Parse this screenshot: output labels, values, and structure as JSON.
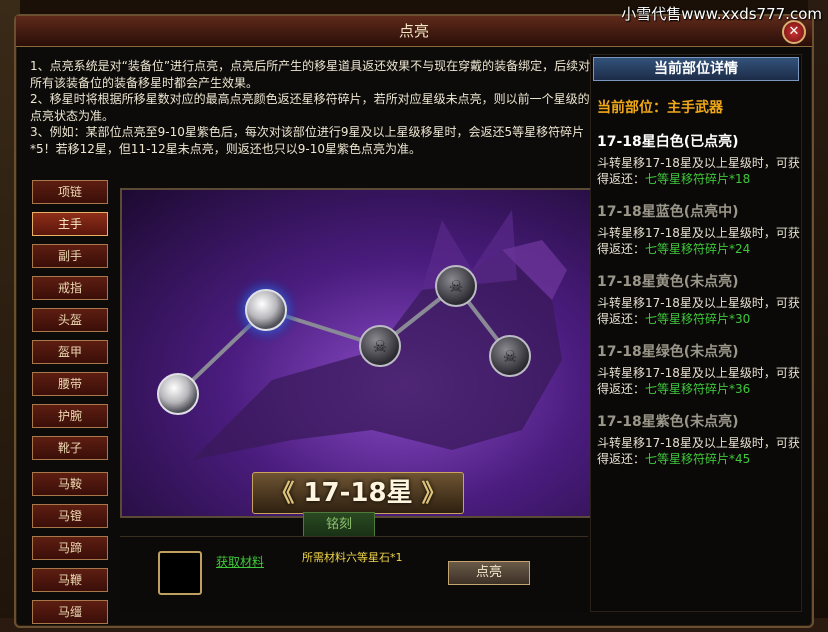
{
  "watermark": "小雪代售www.xxds777.com",
  "window": {
    "title": "点亮",
    "close_icon": "close-icon"
  },
  "notes": [
    "1、点亮系统是对“装备位”进行点亮，点亮后所产生的移星道具返还效果不与现在穿戴的装备绑定，后续对所有该装备位的装备移星时都会产生效果。",
    "2、移星时将根据所移星数对应的最高点亮颜色返还星移符碎片，若所对应星级未点亮，则以前一个星级的点亮状态为准。",
    "3、例如：某部位点亮至9-10星紫色后，每次对该部位进行9星及以上星级移星时，会返还5等星移符碎片*5！若移12星，但11-12星未点亮，则返还也只以9-10星紫色点亮为准。"
  ],
  "equipment_tabs": [
    "项链",
    "主手",
    "副手",
    "戒指",
    "头盔",
    "盔甲",
    "腰带",
    "护腕",
    "靴子"
  ],
  "mount_tabs": [
    "马鞍",
    "马镫",
    "马蹄",
    "马鞭",
    "马缰"
  ],
  "active_tab": "主手",
  "star_banner": {
    "left": "《",
    "label": "17-18星",
    "right": "》"
  },
  "engrave_label": "铭刻",
  "bottom": {
    "acquire_label": "获取材料",
    "required_text": "所需材料六等星石*1",
    "light_button": "点亮"
  },
  "detail": {
    "header": "当前部位详情",
    "part_title": "当前部位：主手武器",
    "desc_prefix": "斗转星移17-18星及以上星级时，可获得返还：",
    "tiers": [
      {
        "name": "17-18星白色(已点亮)",
        "reward": "七等星移符碎片*18",
        "lit": true
      },
      {
        "name": "17-18星蓝色(点亮中)",
        "reward": "七等星移符碎片*24",
        "lit": false
      },
      {
        "name": "17-18星黄色(未点亮)",
        "reward": "七等星移符碎片*30",
        "lit": false
      },
      {
        "name": "17-18星绿色(未点亮)",
        "reward": "七等星移符碎片*36",
        "lit": false
      },
      {
        "name": "17-18星紫色(未点亮)",
        "reward": "七等星移符碎片*45",
        "lit": false
      }
    ]
  },
  "colors": {
    "accent_gold": "#f0a818",
    "reward_green": "#3fc83a",
    "header_blue": "#33527a"
  }
}
